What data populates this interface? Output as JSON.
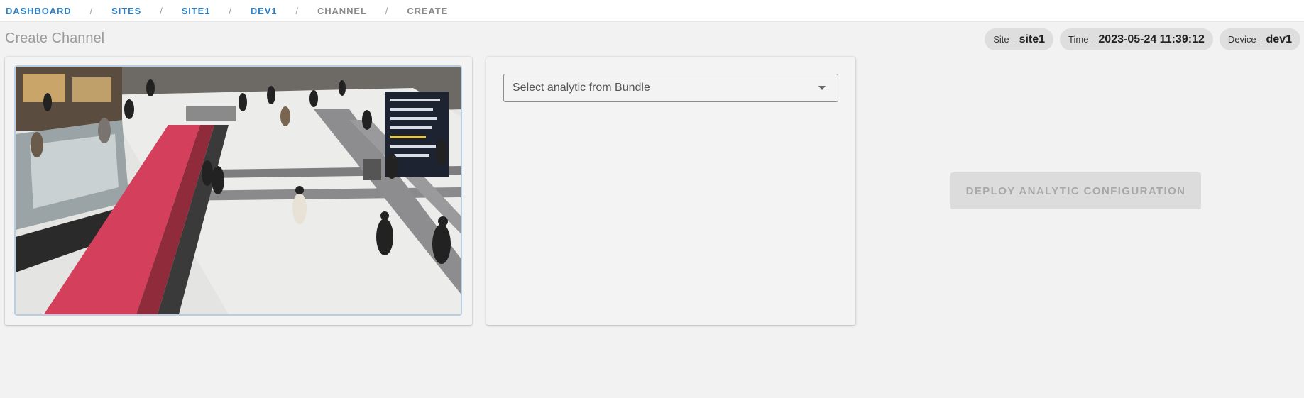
{
  "breadcrumb": [
    {
      "label": "DASHBOARD",
      "link": true
    },
    {
      "label": "SITES",
      "link": true
    },
    {
      "label": "SITE1",
      "link": true
    },
    {
      "label": "DEV1",
      "link": true
    },
    {
      "label": "CHANNEL",
      "link": false
    },
    {
      "label": "CREATE",
      "link": false
    }
  ],
  "breadcrumb_separator": "/",
  "page_title": "Create Channel",
  "chips": {
    "site": {
      "label": "Site -",
      "value": "site1"
    },
    "time": {
      "label": "Time -",
      "value": "2023-05-24 11:39:12"
    },
    "device": {
      "label": "Device -",
      "value": "dev1"
    }
  },
  "video": {
    "description_icon": "camera-feed-image"
  },
  "analytic_select": {
    "placeholder": "Select analytic from Bundle"
  },
  "deploy_button": {
    "label": "DEPLOY ANALYTIC CONFIGURATION",
    "disabled": true
  },
  "colors": {
    "link": "#2f7fc2",
    "crumb_inactive": "#8a8a8a",
    "chip_bg": "#dedede",
    "button_disabled_bg": "#dcdcdc"
  }
}
